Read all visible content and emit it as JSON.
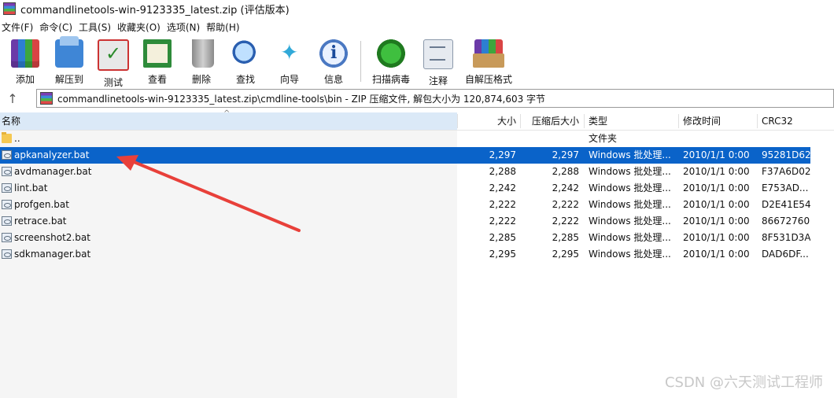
{
  "window": {
    "title": "commandlinetools-win-9123335_latest.zip (评估版本)"
  },
  "menu": [
    "文件(F)",
    "命令(C)",
    "工具(S)",
    "收藏夹(O)",
    "选项(N)",
    "帮助(H)"
  ],
  "toolbar": {
    "add": "添加",
    "extract": "解压到",
    "test": "测试",
    "view": "查看",
    "delete": "删除",
    "find": "查找",
    "wizard": "向导",
    "info": "信息",
    "scan": "扫描病毒",
    "comment": "注释",
    "sfx": "自解压格式"
  },
  "address": {
    "up_icon": "up-arrow-icon",
    "text": "commandlinetools-win-9123335_latest.zip\\cmdline-tools\\bin - ZIP 压缩文件, 解包大小为 120,874,603 字节"
  },
  "columns": {
    "name": "名称",
    "size": "大小",
    "packed": "压缩后大小",
    "type": "类型",
    "modified": "修改时间",
    "crc": "CRC32"
  },
  "files": [
    {
      "name": "..",
      "size": "",
      "packed": "",
      "type": "文件夹",
      "modified": "",
      "crc": "",
      "icon": "folder-icon",
      "selected": false
    },
    {
      "name": "apkanalyzer.bat",
      "size": "2,297",
      "packed": "2,297",
      "type": "Windows 批处理...",
      "modified": "2010/1/1 0:00",
      "crc": "95281D62",
      "icon": "batch-file-icon",
      "selected": true
    },
    {
      "name": "avdmanager.bat",
      "size": "2,288",
      "packed": "2,288",
      "type": "Windows 批处理...",
      "modified": "2010/1/1 0:00",
      "crc": "F37A6D02",
      "icon": "batch-file-icon",
      "selected": false
    },
    {
      "name": "lint.bat",
      "size": "2,242",
      "packed": "2,242",
      "type": "Windows 批处理...",
      "modified": "2010/1/1 0:00",
      "crc": "E753AD...",
      "icon": "batch-file-icon",
      "selected": false
    },
    {
      "name": "profgen.bat",
      "size": "2,222",
      "packed": "2,222",
      "type": "Windows 批处理...",
      "modified": "2010/1/1 0:00",
      "crc": "D2E41E54",
      "icon": "batch-file-icon",
      "selected": false
    },
    {
      "name": "retrace.bat",
      "size": "2,222",
      "packed": "2,222",
      "type": "Windows 批处理...",
      "modified": "2010/1/1 0:00",
      "crc": "86672760",
      "icon": "batch-file-icon",
      "selected": false
    },
    {
      "name": "screenshot2.bat",
      "size": "2,285",
      "packed": "2,285",
      "type": "Windows 批处理...",
      "modified": "2010/1/1 0:00",
      "crc": "8F531D3A",
      "icon": "batch-file-icon",
      "selected": false
    },
    {
      "name": "sdkmanager.bat",
      "size": "2,295",
      "packed": "2,295",
      "type": "Windows 批处理...",
      "modified": "2010/1/1 0:00",
      "crc": "DAD6DF...",
      "icon": "batch-file-icon",
      "selected": false
    }
  ],
  "annotation": {
    "color": "#e8403a"
  },
  "watermark": "CSDN @六天测试工程师",
  "colors": {
    "selection": "#0a63c9",
    "name_column_bg": "#dbe9f7"
  }
}
